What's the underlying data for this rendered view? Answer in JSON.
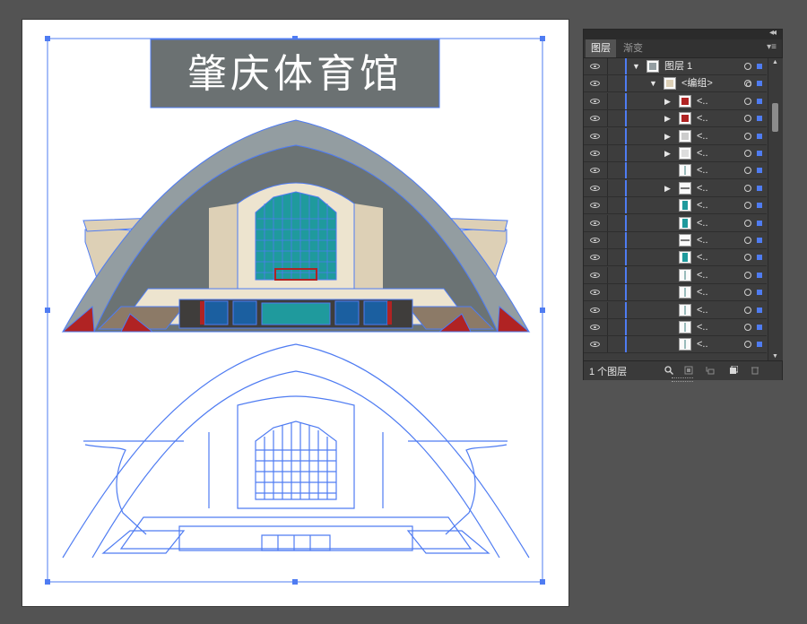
{
  "artboard": {
    "title_text": "肇庆体育馆",
    "colors": {
      "roof": "#939da1",
      "inner_dark": "#6b7374",
      "beige": "#ddd0b6",
      "cream": "#ede4cf",
      "teal": "#1f9a9d",
      "red": "#b02323",
      "brown": "#8c7a67",
      "dark": "#3f3d3b",
      "selection": "#4f7cf2",
      "title_bg": "#6b7172"
    }
  },
  "panel": {
    "collapse_icon": "double-chevron-left-icon",
    "tabs": [
      {
        "label": "图层",
        "active": true
      },
      {
        "label": "渐变",
        "active": false
      }
    ],
    "menu_icon": "panel-menu-icon",
    "rows": [
      {
        "name": "图层 1",
        "expander": "open",
        "thumb": "layer",
        "target": "circle"
      },
      {
        "name": "<编组>",
        "expander": "open",
        "thumb": "building",
        "target": "ring"
      },
      {
        "name": "<..",
        "expander": "closed",
        "thumb": "red"
      },
      {
        "name": "<..",
        "expander": "closed",
        "thumb": "red"
      },
      {
        "name": "<..",
        "expander": "closed",
        "thumb": "dash"
      },
      {
        "name": "<..",
        "expander": "closed",
        "thumb": "thin"
      },
      {
        "name": "<..",
        "expander": "none",
        "thumb": "white"
      },
      {
        "name": "<..",
        "expander": "closed",
        "thumb": "bars"
      },
      {
        "name": "<..",
        "expander": "none",
        "thumb": "teal"
      },
      {
        "name": "<..",
        "expander": "none",
        "thumb": "teal"
      },
      {
        "name": "<..",
        "expander": "none",
        "thumb": "bars"
      },
      {
        "name": "<..",
        "expander": "none",
        "thumb": "teal"
      },
      {
        "name": "<..",
        "expander": "none",
        "thumb": "white"
      },
      {
        "name": "<..",
        "expander": "none",
        "thumb": "white"
      },
      {
        "name": "<..",
        "expander": "none",
        "thumb": "white"
      },
      {
        "name": "<..",
        "expander": "none",
        "thumb": "white"
      },
      {
        "name": "<..",
        "expander": "none",
        "thumb": "white"
      }
    ],
    "footer": {
      "layer_count": "1 个图层",
      "icons": [
        "search-icon",
        "make-clipping-mask-icon",
        "create-sublayer-icon",
        "new-layer-icon",
        "trash-icon"
      ]
    }
  }
}
